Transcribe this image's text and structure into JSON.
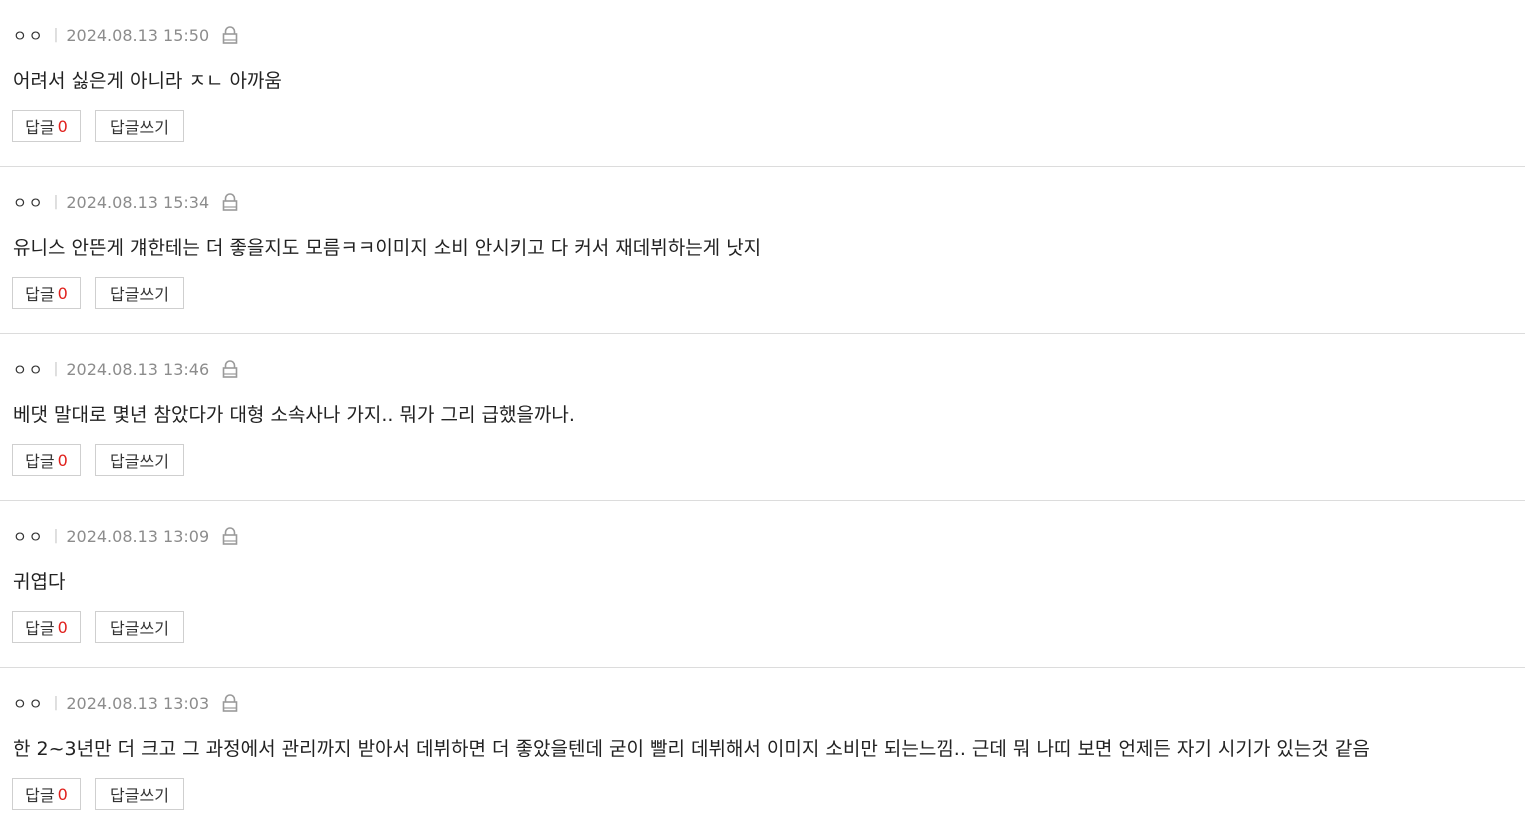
{
  "comments": [
    {
      "author": "ㅇㅇ",
      "separator": "|",
      "date": "2024.08.13 15:50",
      "text": "어려서 싫은게 아니라 ㅈㄴ 아까움",
      "reply_label": "답글",
      "reply_count": "0",
      "write_reply_label": "답글쓰기"
    },
    {
      "author": "ㅇㅇ",
      "separator": "|",
      "date": "2024.08.13 15:34",
      "text": "유니스 안뜬게 걔한테는 더 좋을지도 모름ㅋㅋ이미지 소비 안시키고 다 커서 재데뷔하는게 낫지",
      "reply_label": "답글",
      "reply_count": "0",
      "write_reply_label": "답글쓰기"
    },
    {
      "author": "ㅇㅇ",
      "separator": "|",
      "date": "2024.08.13 13:46",
      "text": "베댓 말대로 몇년 참았다가 대형 소속사나 가지.. 뭐가 그리 급했을까나.",
      "reply_label": "답글",
      "reply_count": "0",
      "write_reply_label": "답글쓰기"
    },
    {
      "author": "ㅇㅇ",
      "separator": "|",
      "date": "2024.08.13 13:09",
      "text": "귀엽다",
      "reply_label": "답글",
      "reply_count": "0",
      "write_reply_label": "답글쓰기"
    },
    {
      "author": "ㅇㅇ",
      "separator": "|",
      "date": "2024.08.13 13:03",
      "text": "한 2~3년만 더 크고 그 과정에서 관리까지 받아서 데뷔하면 더 좋았을텐데 굳이 빨리 데뷔해서 이미지 소비만 되는느낌.. 근데 뭐 나띠 보면 언제든 자기 시기가 있는것 같음",
      "reply_label": "답글",
      "reply_count": "0",
      "write_reply_label": "답글쓰기"
    }
  ],
  "icons": {
    "lock": "lock-icon"
  },
  "colors": {
    "reply_count": "#e0201c",
    "date": "#8c8c8c",
    "divider": "#dcdcdc"
  }
}
